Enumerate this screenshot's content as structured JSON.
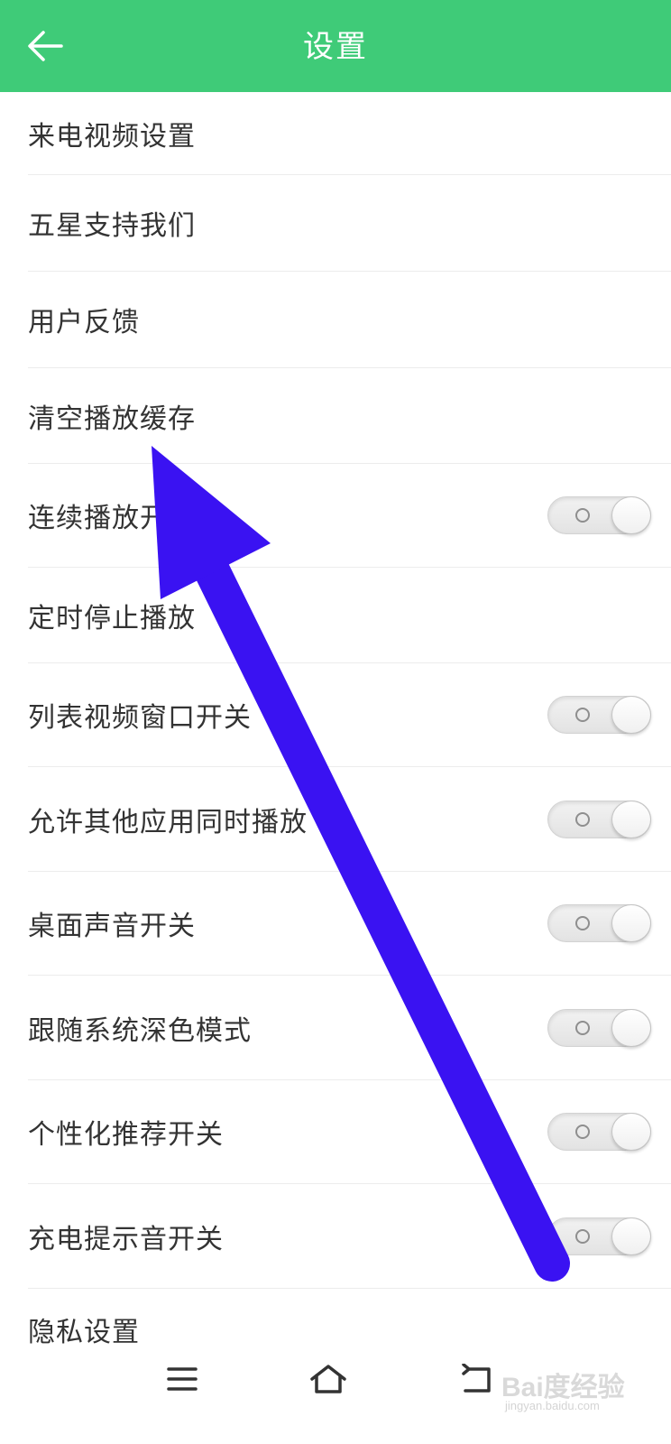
{
  "colors": {
    "header_bg": "#3fcb78",
    "annotation_arrow": "#3a12f2"
  },
  "header": {
    "title": "设置",
    "back_icon": "arrow-left-icon"
  },
  "settings": [
    {
      "label": "来电视频设置",
      "has_toggle": false
    },
    {
      "label": "五星支持我们",
      "has_toggle": false
    },
    {
      "label": "用户反馈",
      "has_toggle": false
    },
    {
      "label": "清空播放缓存",
      "has_toggle": false
    },
    {
      "label": "连续播放开关",
      "has_toggle": true,
      "toggle_on": false
    },
    {
      "label": "定时停止播放",
      "has_toggle": false
    },
    {
      "label": "列表视频窗口开关",
      "has_toggle": true,
      "toggle_on": false
    },
    {
      "label": "允许其他应用同时播放",
      "has_toggle": true,
      "toggle_on": false
    },
    {
      "label": "桌面声音开关",
      "has_toggle": true,
      "toggle_on": false
    },
    {
      "label": "跟随系统深色模式",
      "has_toggle": true,
      "toggle_on": false
    },
    {
      "label": "个性化推荐开关",
      "has_toggle": true,
      "toggle_on": false
    },
    {
      "label": "充电提示音开关",
      "has_toggle": true,
      "toggle_on": false
    },
    {
      "label": "隐私设置",
      "has_toggle": false
    }
  ],
  "navbar": {
    "menu_icon": "menu-icon",
    "home_icon": "home-icon",
    "back_icon": "back-icon"
  },
  "watermark": {
    "brand": "Bai度经验",
    "url": "jingyan.baidu.com"
  }
}
